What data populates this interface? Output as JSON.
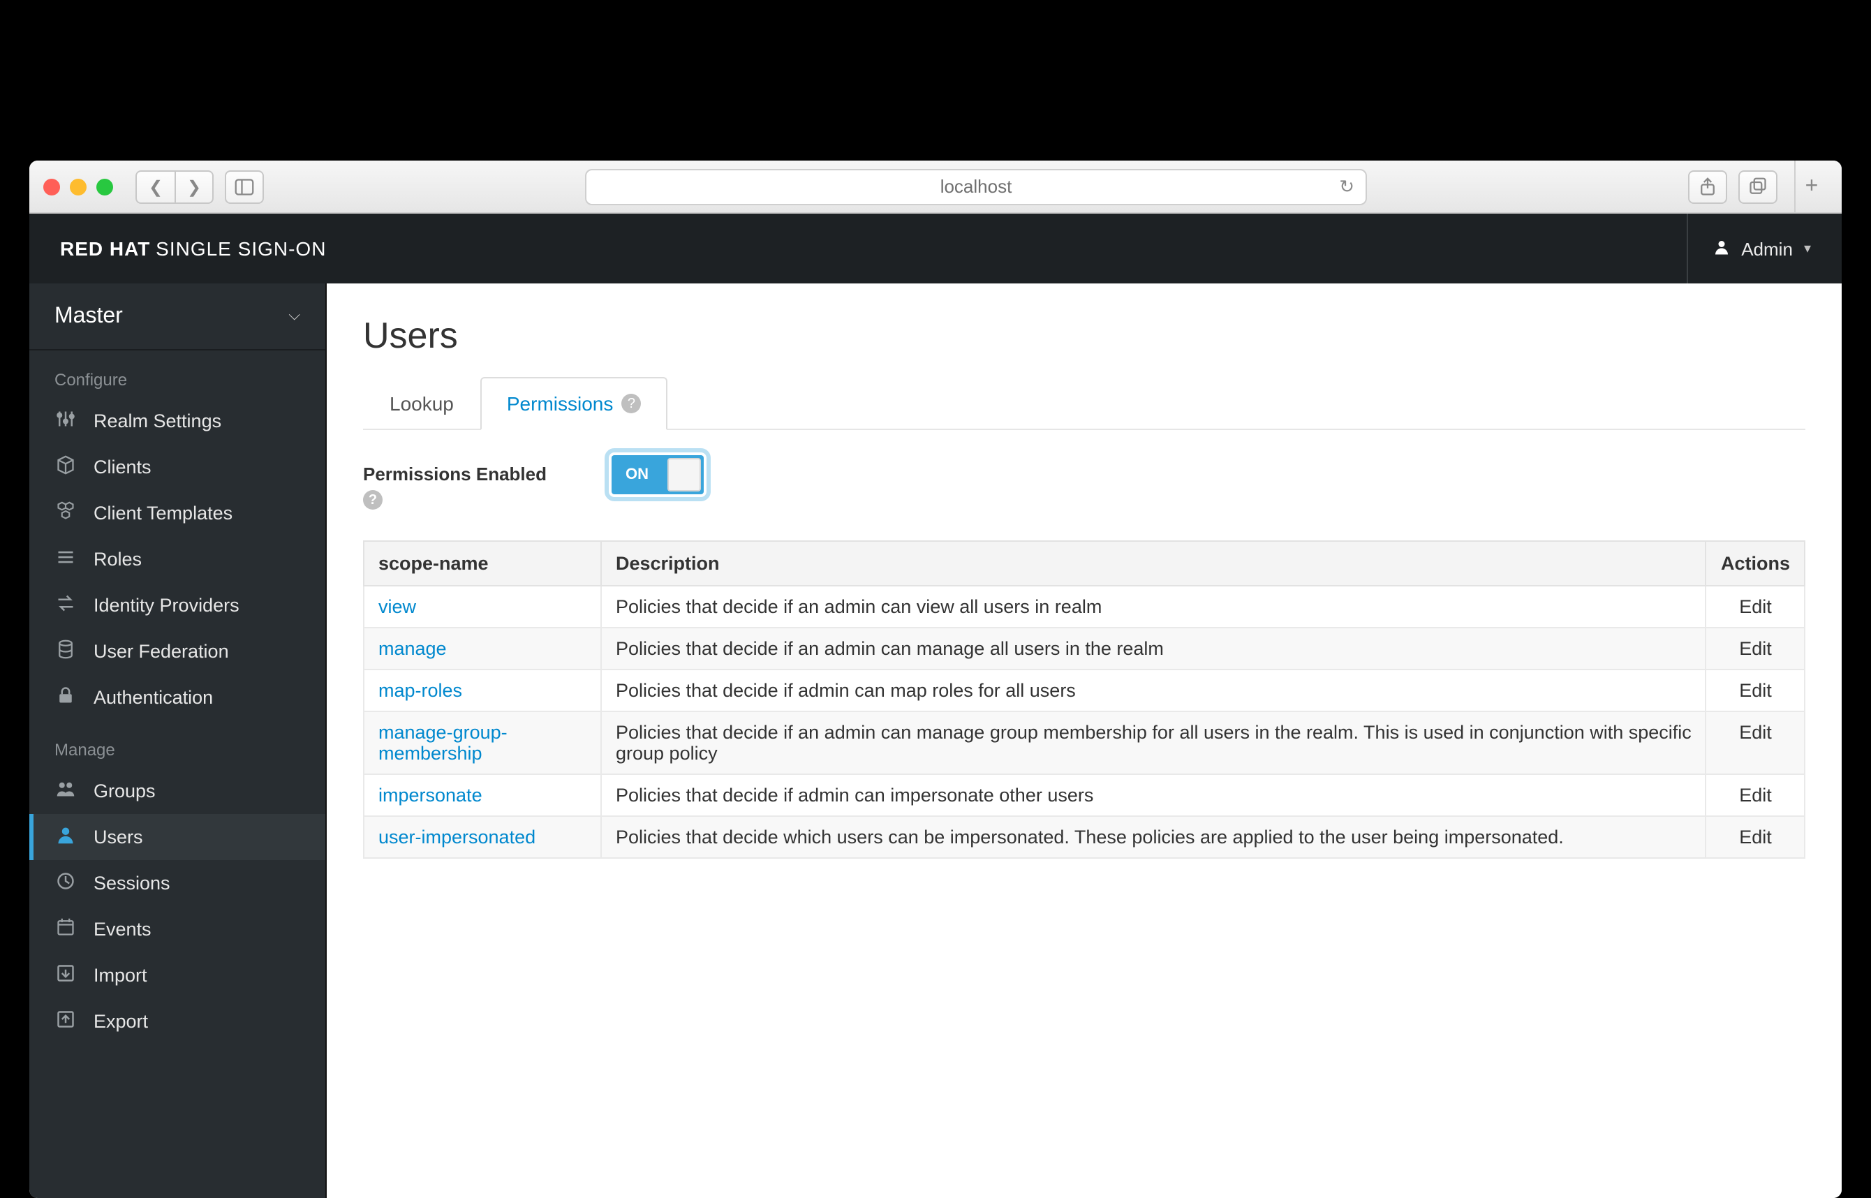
{
  "browser": {
    "address": "localhost"
  },
  "brand": {
    "bold": "RED HAT",
    "light": "SINGLE SIGN-ON"
  },
  "user": {
    "label": "Admin"
  },
  "realm": {
    "name": "Master"
  },
  "sidebar": {
    "configure_label": "Configure",
    "manage_label": "Manage",
    "configure": [
      {
        "label": "Realm Settings",
        "icon": "sliders"
      },
      {
        "label": "Clients",
        "icon": "cube"
      },
      {
        "label": "Client Templates",
        "icon": "cubes"
      },
      {
        "label": "Roles",
        "icon": "list"
      },
      {
        "label": "Identity Providers",
        "icon": "exchange"
      },
      {
        "label": "User Federation",
        "icon": "database"
      },
      {
        "label": "Authentication",
        "icon": "lock"
      }
    ],
    "manage": [
      {
        "label": "Groups",
        "icon": "group"
      },
      {
        "label": "Users",
        "icon": "user",
        "active": true
      },
      {
        "label": "Sessions",
        "icon": "clock"
      },
      {
        "label": "Events",
        "icon": "calendar"
      },
      {
        "label": "Import",
        "icon": "import"
      },
      {
        "label": "Export",
        "icon": "export"
      }
    ]
  },
  "page": {
    "title": "Users",
    "tabs": [
      {
        "label": "Lookup"
      },
      {
        "label": "Permissions",
        "active": true,
        "help": true
      }
    ],
    "permissions_enabled_label": "Permissions Enabled",
    "toggle": {
      "state": "ON"
    }
  },
  "table": {
    "headers": {
      "scope": "scope-name",
      "desc": "Description",
      "actions": "Actions"
    },
    "action_label": "Edit",
    "rows": [
      {
        "scope": "view",
        "desc": "Policies that decide if an admin can view all users in realm"
      },
      {
        "scope": "manage",
        "desc": "Policies that decide if an admin can manage all users in the realm"
      },
      {
        "scope": "map-roles",
        "desc": "Policies that decide if admin can map roles for all users"
      },
      {
        "scope": "manage-group-membership",
        "desc": "Policies that decide if an admin can manage group membership for all users in the realm. This is used in conjunction with specific group policy"
      },
      {
        "scope": "impersonate",
        "desc": "Policies that decide if admin can impersonate other users"
      },
      {
        "scope": "user-impersonated",
        "desc": "Policies that decide which users can be impersonated. These policies are applied to the user being impersonated."
      }
    ]
  }
}
